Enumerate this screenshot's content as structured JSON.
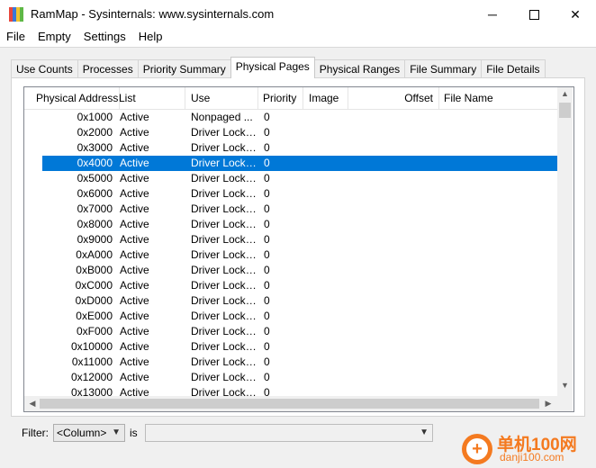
{
  "window": {
    "title": "RamMap - Sysinternals: www.sysinternals.com",
    "minimize": "─",
    "close": "✕",
    "icon_colors": [
      "#e8463c",
      "#3a78d8",
      "#f0c330",
      "#5fb845"
    ]
  },
  "menu": [
    "File",
    "Empty",
    "Settings",
    "Help"
  ],
  "tabs": [
    {
      "label": "Use Counts",
      "active": false
    },
    {
      "label": "Processes",
      "active": false
    },
    {
      "label": "Priority Summary",
      "active": false
    },
    {
      "label": "Physical Pages",
      "active": true
    },
    {
      "label": "Physical Ranges",
      "active": false
    },
    {
      "label": "File Summary",
      "active": false
    },
    {
      "label": "File Details",
      "active": false
    }
  ],
  "columns": [
    "Physical Address",
    "List",
    "Use",
    "Priority",
    "Image",
    "Offset",
    "File Name"
  ],
  "rows": [
    {
      "address": "0x1000",
      "list": "Active",
      "use": "Nonpaged ...",
      "priority": "0"
    },
    {
      "address": "0x2000",
      "list": "Active",
      "use": "Driver Locked",
      "priority": "0"
    },
    {
      "address": "0x3000",
      "list": "Active",
      "use": "Driver Locked",
      "priority": "0"
    },
    {
      "address": "0x4000",
      "list": "Active",
      "use": "Driver Locked",
      "priority": "0",
      "selected": true
    },
    {
      "address": "0x5000",
      "list": "Active",
      "use": "Driver Locked",
      "priority": "0"
    },
    {
      "address": "0x6000",
      "list": "Active",
      "use": "Driver Locked",
      "priority": "0"
    },
    {
      "address": "0x7000",
      "list": "Active",
      "use": "Driver Locked",
      "priority": "0"
    },
    {
      "address": "0x8000",
      "list": "Active",
      "use": "Driver Locked",
      "priority": "0"
    },
    {
      "address": "0x9000",
      "list": "Active",
      "use": "Driver Locked",
      "priority": "0"
    },
    {
      "address": "0xA000",
      "list": "Active",
      "use": "Driver Locked",
      "priority": "0"
    },
    {
      "address": "0xB000",
      "list": "Active",
      "use": "Driver Locked",
      "priority": "0"
    },
    {
      "address": "0xC000",
      "list": "Active",
      "use": "Driver Locked",
      "priority": "0"
    },
    {
      "address": "0xD000",
      "list": "Active",
      "use": "Driver Locked",
      "priority": "0"
    },
    {
      "address": "0xE000",
      "list": "Active",
      "use": "Driver Locked",
      "priority": "0"
    },
    {
      "address": "0xF000",
      "list": "Active",
      "use": "Driver Locked",
      "priority": "0"
    },
    {
      "address": "0x10000",
      "list": "Active",
      "use": "Driver Locked",
      "priority": "0"
    },
    {
      "address": "0x11000",
      "list": "Active",
      "use": "Driver Locked",
      "priority": "0"
    },
    {
      "address": "0x12000",
      "list": "Active",
      "use": "Driver Locked",
      "priority": "0"
    },
    {
      "address": "0x13000",
      "list": "Active",
      "use": "Driver Locked",
      "priority": "0"
    }
  ],
  "filter": {
    "label": "Filter:",
    "column_value": "<Column>",
    "is_label": "is",
    "value": ""
  },
  "watermark": {
    "text": "单机100网",
    "url": "danji100.com",
    "color": "#f47a20"
  },
  "colors": {
    "selection": "#0078d7"
  }
}
